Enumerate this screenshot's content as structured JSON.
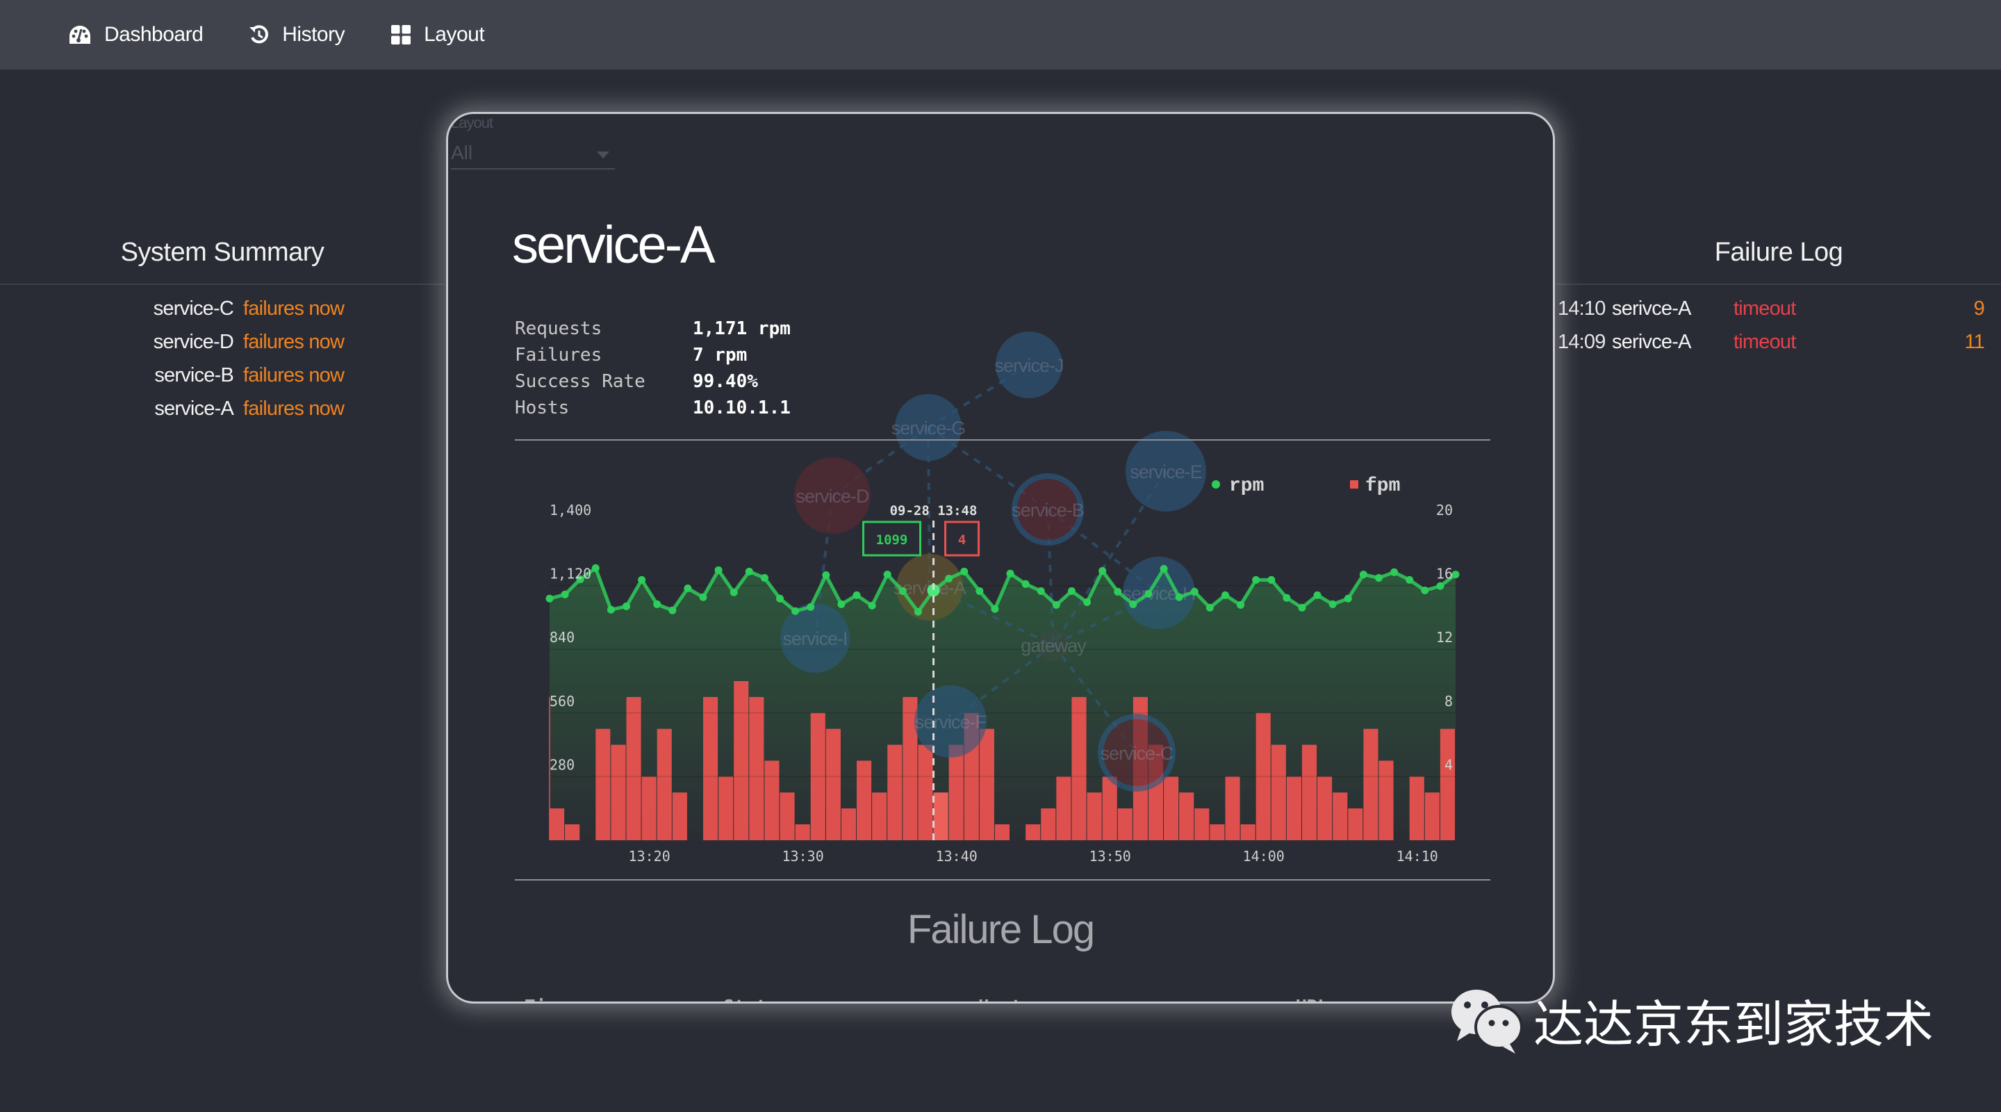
{
  "nav": {
    "items": [
      {
        "label": "Dashboard",
        "icon": "dashboard-gauge-icon"
      },
      {
        "label": "History",
        "icon": "history-icon"
      },
      {
        "label": "Layout",
        "icon": "layout-grid-icon"
      }
    ]
  },
  "summary": {
    "title": "System Summary",
    "rows": [
      {
        "service": "service-C",
        "state": "failures now"
      },
      {
        "service": "service-D",
        "state": "failures now"
      },
      {
        "service": "service-B",
        "state": "failures now"
      },
      {
        "service": "service-A",
        "state": "failures now"
      }
    ]
  },
  "failure_log_panel": {
    "title": "Failure Log",
    "rows": [
      {
        "time": "14:10",
        "service": "serivce-A",
        "reason": "timeout",
        "count": "9"
      },
      {
        "time": "14:09",
        "service": "serivce-A",
        "reason": "timeout",
        "count": "11"
      }
    ]
  },
  "modal": {
    "layout_select": {
      "label": "Layout",
      "value": "All"
    },
    "service_name": "service-A",
    "stats": [
      {
        "key": "Requests",
        "value": "1,171 rpm"
      },
      {
        "key": "Failures",
        "value": "7 rpm"
      },
      {
        "key": "Success Rate",
        "value": "99.40%"
      },
      {
        "key": "Hosts",
        "value": "10.10.1.1"
      }
    ],
    "failure_log": {
      "title": "Failure Log",
      "columns": [
        "Time",
        "Status",
        "Host",
        "URL"
      ]
    }
  },
  "topology": {
    "nodes": [
      {
        "name": "service-J",
        "status": "normal"
      },
      {
        "name": "service-G",
        "status": "normal"
      },
      {
        "name": "service-D",
        "status": "failing"
      },
      {
        "name": "service-B",
        "status": "failing"
      },
      {
        "name": "service-E",
        "status": "normal"
      },
      {
        "name": "service-A",
        "status": "selected"
      },
      {
        "name": "service-H",
        "status": "normal"
      },
      {
        "name": "service-I",
        "status": "normal"
      },
      {
        "name": "gateway",
        "status": "gateway"
      },
      {
        "name": "service-F",
        "status": "normal"
      },
      {
        "name": "service-C",
        "status": "failing"
      }
    ],
    "links": [
      [
        "service-G",
        "service-J"
      ],
      [
        "service-G",
        "service-D"
      ],
      [
        "service-G",
        "service-A"
      ],
      [
        "service-G",
        "service-B"
      ],
      [
        "service-D",
        "service-I"
      ],
      [
        "service-A",
        "gateway"
      ],
      [
        "service-B",
        "gateway"
      ],
      [
        "service-E",
        "gateway"
      ],
      [
        "service-H",
        "gateway"
      ],
      [
        "gateway",
        "service-F"
      ],
      [
        "gateway",
        "service-C"
      ],
      [
        "service-B",
        "service-H"
      ]
    ]
  },
  "colors": {
    "rpm": "#2ecc5a",
    "fpm": "#e8524f",
    "failing_text": "#f08320",
    "timeout": "#e8404a",
    "node_normal": "#2c5a80",
    "node_failing": "#5c2a33",
    "node_selected": "#6b5a2e"
  },
  "chart_data": {
    "type": "bar+line",
    "title": "",
    "legend": [
      "rpm",
      "fpm"
    ],
    "legend_position": "top-right",
    "x_ticks": [
      "13:20",
      "13:30",
      "13:40",
      "13:50",
      "14:00",
      "14:10"
    ],
    "y_left": {
      "label": "rpm",
      "ticks": [
        "280",
        "560",
        "840",
        "1,120",
        "1,400"
      ],
      "range": [
        0,
        1400
      ]
    },
    "y_right": {
      "label": "fpm",
      "ticks": [
        "4",
        "8",
        "12",
        "16",
        "20"
      ],
      "range": [
        0,
        20
      ]
    },
    "x_range_minutes": [
      "13:14",
      "14:13"
    ],
    "series": [
      {
        "name": "rpm",
        "type": "line",
        "values": [
          1063,
          1081,
          1148,
          1197,
          1014,
          1029,
          1145,
          1038,
          1011,
          1108,
          1069,
          1188,
          1090,
          1182,
          1154,
          1063,
          1008,
          1026,
          1166,
          1038,
          1078,
          1032,
          1169,
          1096,
          1005,
          1099,
          1151,
          1182,
          1096,
          1017,
          1173,
          1127,
          1096,
          1035,
          1096,
          1047,
          1185,
          1093,
          1038,
          1084,
          1194,
          1069,
          1093,
          1023,
          1078,
          1035,
          1145,
          1145,
          1066,
          1023,
          1078,
          1038,
          1063,
          1169,
          1154,
          1179,
          1145,
          1099,
          1118,
          1169
        ]
      },
      {
        "name": "fpm",
        "type": "bar",
        "values": [
          2,
          1,
          0,
          7,
          6,
          9,
          4,
          7,
          3,
          0,
          9,
          4,
          10,
          9,
          5,
          3,
          1,
          8,
          7,
          2,
          5,
          3,
          6,
          9,
          6,
          3,
          6,
          8,
          7,
          1,
          0,
          1,
          2,
          4,
          9,
          3,
          4,
          2,
          9,
          6,
          4,
          3,
          2,
          1,
          4,
          1,
          8,
          6,
          4,
          6,
          4,
          3,
          2,
          7,
          5,
          0,
          4,
          3,
          7
        ]
      }
    ],
    "tooltip": {
      "time": "09-28 13:48",
      "rpm": "1099",
      "fpm": "4",
      "index": 25
    }
  }
}
